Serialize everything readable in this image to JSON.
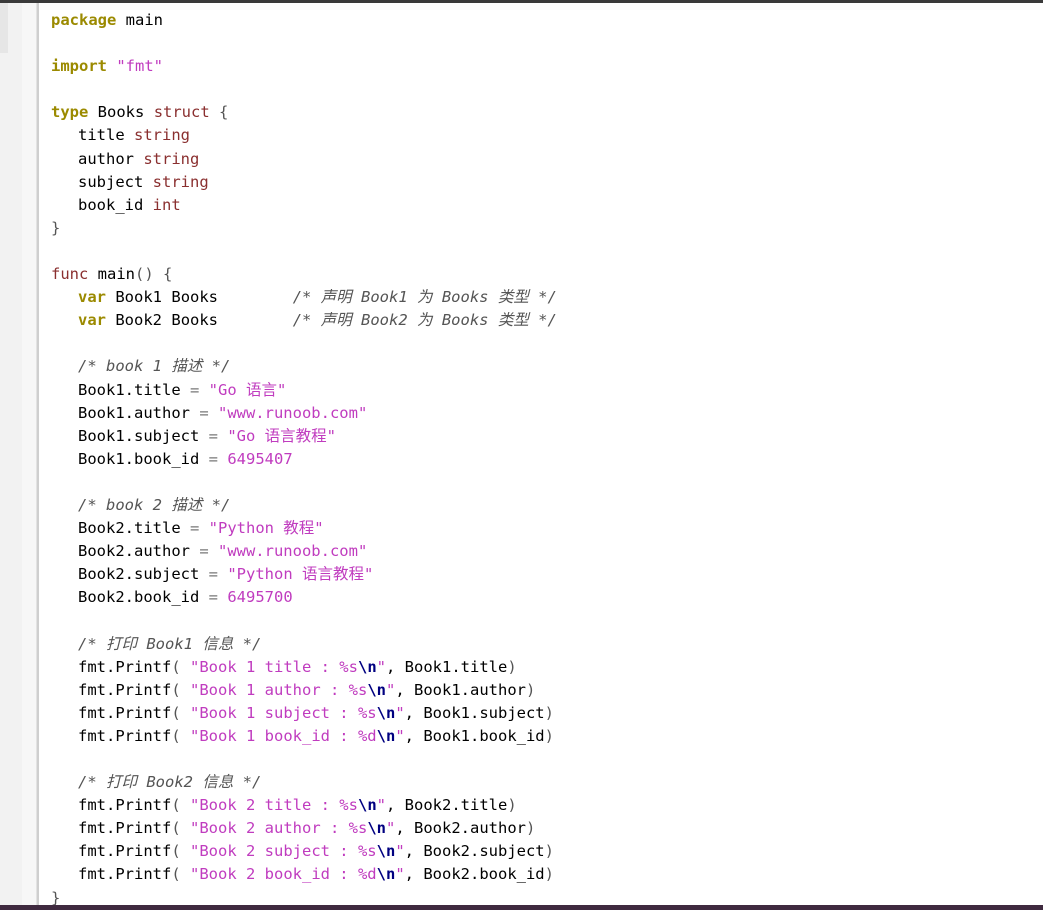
{
  "code": {
    "package_kw": "package",
    "package_name": "main",
    "import_kw": "import",
    "import_path": "\"fmt\"",
    "type_kw": "type",
    "type_name": "Books",
    "struct_kw": "struct",
    "open_brace": "{",
    "close_brace": "}",
    "fields": [
      {
        "name": "title",
        "type": "string"
      },
      {
        "name": "author",
        "type": "string"
      },
      {
        "name": "subject",
        "type": "string"
      },
      {
        "name": "book_id",
        "type": "int"
      }
    ],
    "func_kw": "func",
    "func_name": "main",
    "func_parens": "()",
    "vars": [
      {
        "kw": "var",
        "name": "Book1",
        "type": "Books",
        "comment": "/* 声明 Book1 为 Books 类型 */"
      },
      {
        "kw": "var",
        "name": "Book2",
        "type": "Books",
        "comment": "/* 声明 Book2 为 Books 类型 */"
      }
    ],
    "comment_book1": "/* book 1 描述 */",
    "assign_book1": [
      {
        "target": "Book1.title",
        "value": "\"Go 语言\"",
        "kind": "str"
      },
      {
        "target": "Book1.author",
        "value": "\"www.runoob.com\"",
        "kind": "str"
      },
      {
        "target": "Book1.subject",
        "value": "\"Go 语言教程\"",
        "kind": "str"
      },
      {
        "target": "Book1.book_id",
        "value": "6495407",
        "kind": "num"
      }
    ],
    "comment_book2": "/* book 2 描述 */",
    "assign_book2": [
      {
        "target": "Book2.title",
        "value": "\"Python 教程\"",
        "kind": "str"
      },
      {
        "target": "Book2.author",
        "value": "\"www.runoob.com\"",
        "kind": "str"
      },
      {
        "target": "Book2.subject",
        "value": "\"Python 语言教程\"",
        "kind": "str"
      },
      {
        "target": "Book2.book_id",
        "value": "6495700",
        "kind": "num"
      }
    ],
    "comment_print1": "/* 打印 Book1 信息 */",
    "printf_book1": [
      {
        "fmt": "\"Book 1 title : %s",
        "arg": "Book1.title"
      },
      {
        "fmt": "\"Book 1 author : %s",
        "arg": "Book1.author"
      },
      {
        "fmt": "\"Book 1 subject : %s",
        "arg": "Book1.subject"
      },
      {
        "fmt": "\"Book 1 book_id : %d",
        "arg": "Book1.book_id"
      }
    ],
    "comment_print2": "/* 打印 Book2 信息 */",
    "printf_book2": [
      {
        "fmt": "\"Book 2 title : %s",
        "arg": "Book2.title"
      },
      {
        "fmt": "\"Book 2 author : %s",
        "arg": "Book2.author"
      },
      {
        "fmt": "\"Book 2 subject : %s",
        "arg": "Book2.subject"
      },
      {
        "fmt": "\"Book 2 book_id : %d",
        "arg": "Book2.book_id"
      }
    ],
    "printf_call": "fmt.Printf",
    "escape_newline": "\\n",
    "quote": "\"",
    "comma_sep": ", ",
    "paren_open": "( ",
    "paren_close": ")",
    "equals": " = "
  },
  "colors": {
    "keyword": "#9b8a00",
    "type": "#8a2f2f",
    "string": "#c03cbf",
    "comment": "#555555",
    "escape": "#000080"
  }
}
